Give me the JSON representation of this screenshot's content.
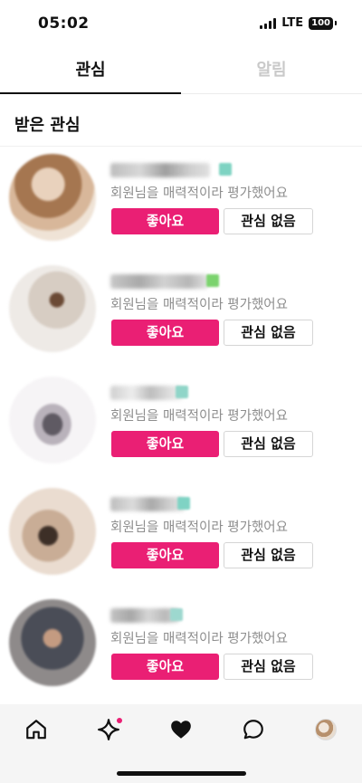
{
  "status_bar": {
    "time": "05:02",
    "network": "LTE",
    "battery": "100"
  },
  "tabs": [
    {
      "label": "관심",
      "active": true
    },
    {
      "label": "알림",
      "active": false
    }
  ],
  "section": {
    "title": "받은 관심"
  },
  "likes": [
    {
      "subtitle": "회원님을 매력적이라 평가했어요",
      "like_label": "좋아요",
      "pass_label": "관심 없음"
    },
    {
      "subtitle": "회원님을 매력적이라 평가했어요",
      "like_label": "좋아요",
      "pass_label": "관심 없음"
    },
    {
      "subtitle": "회원님을 매력적이라 평가했어요",
      "like_label": "좋아요",
      "pass_label": "관심 없음"
    },
    {
      "subtitle": "회원님을 매력적이라 평가했어요",
      "like_label": "좋아요",
      "pass_label": "관심 없음"
    },
    {
      "subtitle": "회원님을 매력적이라 평가했어요",
      "like_label": "좋아요",
      "pass_label": "관심 없음"
    }
  ],
  "bottom_nav": [
    {
      "icon": "home-icon"
    },
    {
      "icon": "sparkle-icon",
      "badge": true
    },
    {
      "icon": "heart-icon",
      "active": true
    },
    {
      "icon": "chat-bubble-icon"
    },
    {
      "icon": "profile-avatar-icon"
    }
  ],
  "colors": {
    "accent": "#ea1f74",
    "text": "#111111",
    "muted": "#8e8e8e",
    "inactive_tab": "#c9c9c9",
    "nav_background": "#f5f5f5"
  }
}
